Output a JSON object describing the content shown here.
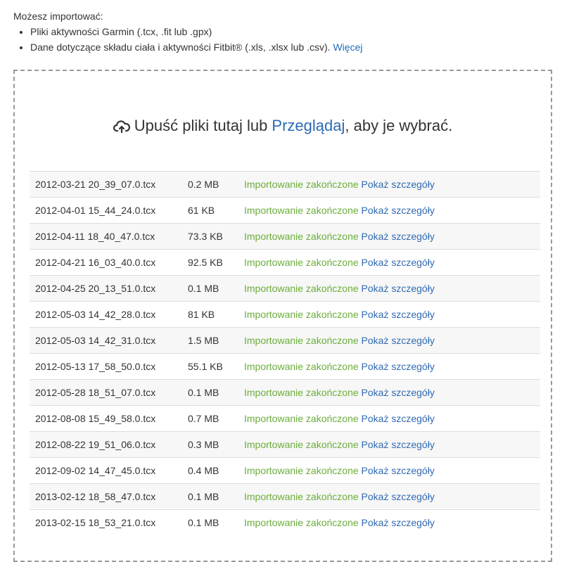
{
  "intro": {
    "heading": "Możesz importować:",
    "bullets": [
      "Pliki aktywności Garmin (.tcx, .fit lub .gpx)",
      "Dane dotyczące składu ciała i aktywności Fitbit® (.xls, .xlsx lub .csv)."
    ],
    "more_link": "Więcej"
  },
  "dropzone": {
    "icon": "cloud-upload-icon",
    "text_before": "Upuść pliki tutaj lub ",
    "browse_link": "Przeglądaj",
    "text_after": ", aby je wybrać."
  },
  "files": [
    {
      "name": "2012-03-21 20_39_07.0.tcx",
      "size": "0.2 MB",
      "status": "Importowanie zakończone",
      "details": "Pokaż szczegóły"
    },
    {
      "name": "2012-04-01 15_44_24.0.tcx",
      "size": "61 KB",
      "status": "Importowanie zakończone",
      "details": "Pokaż szczegóły"
    },
    {
      "name": "2012-04-11 18_40_47.0.tcx",
      "size": "73.3 KB",
      "status": "Importowanie zakończone",
      "details": "Pokaż szczegóły"
    },
    {
      "name": "2012-04-21 16_03_40.0.tcx",
      "size": "92.5 KB",
      "status": "Importowanie zakończone",
      "details": "Pokaż szczegóły"
    },
    {
      "name": "2012-04-25 20_13_51.0.tcx",
      "size": "0.1 MB",
      "status": "Importowanie zakończone",
      "details": "Pokaż szczegóły"
    },
    {
      "name": "2012-05-03 14_42_28.0.tcx",
      "size": "81 KB",
      "status": "Importowanie zakończone",
      "details": "Pokaż szczegóły"
    },
    {
      "name": "2012-05-03 14_42_31.0.tcx",
      "size": "1.5 MB",
      "status": "Importowanie zakończone",
      "details": "Pokaż szczegóły"
    },
    {
      "name": "2012-05-13 17_58_50.0.tcx",
      "size": "55.1 KB",
      "status": "Importowanie zakończone",
      "details": "Pokaż szczegóły"
    },
    {
      "name": "2012-05-28 18_51_07.0.tcx",
      "size": "0.1 MB",
      "status": "Importowanie zakończone",
      "details": "Pokaż szczegóły"
    },
    {
      "name": "2012-08-08 15_49_58.0.tcx",
      "size": "0.7 MB",
      "status": "Importowanie zakończone",
      "details": "Pokaż szczegóły"
    },
    {
      "name": "2012-08-22 19_51_06.0.tcx",
      "size": "0.3 MB",
      "status": "Importowanie zakończone",
      "details": "Pokaż szczegóły"
    },
    {
      "name": "2012-09-02 14_47_45.0.tcx",
      "size": "0.4 MB",
      "status": "Importowanie zakończone",
      "details": "Pokaż szczegóły"
    },
    {
      "name": "2013-02-12 18_58_47.0.tcx",
      "size": "0.1 MB",
      "status": "Importowanie zakończone",
      "details": "Pokaż szczegóły"
    },
    {
      "name": "2013-02-15 18_53_21.0.tcx",
      "size": "0.1 MB",
      "status": "Importowanie zakończone",
      "details": "Pokaż szczegóły"
    }
  ],
  "colors": {
    "status_success": "#6aad3a",
    "link": "#2f6ab1",
    "dropzone_border": "#999999"
  }
}
